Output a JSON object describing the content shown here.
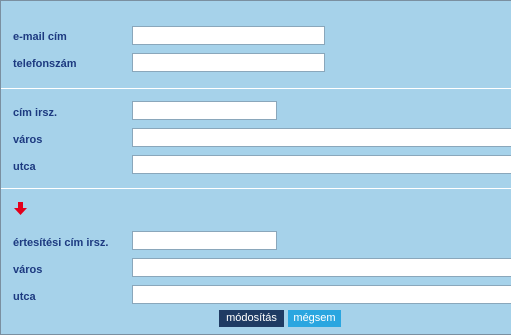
{
  "contact": {
    "email_label": "e-mail cím",
    "email_value": "",
    "phone_label": "telefonszám",
    "phone_value": ""
  },
  "address": {
    "zip_label": "cím irsz.",
    "zip_value": "",
    "city_label": "város",
    "city_value": "",
    "street_label": "utca",
    "street_value": ""
  },
  "copy_icon": "arrow-down-icon",
  "notification_address": {
    "zip_label": "értesítési cím irsz.",
    "zip_value": "",
    "city_label": "város",
    "city_value": "",
    "street_label": "utca",
    "street_value": ""
  },
  "actions": {
    "save_label": "módosítás",
    "cancel_label": "mégsem"
  },
  "colors": {
    "panel_background": "#a6d2ea",
    "label_text": "#1d3a80",
    "save_button": "#1f3b63",
    "cancel_button": "#2aa6e0",
    "arrow": "#e3001b"
  }
}
